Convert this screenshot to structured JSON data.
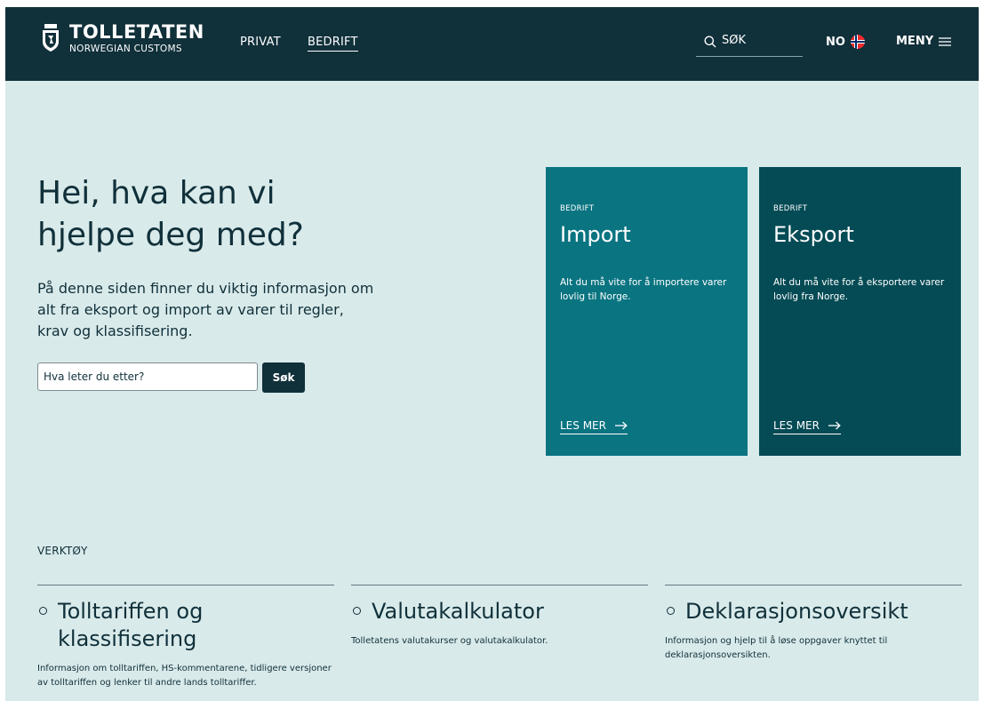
{
  "header": {
    "logo_title": "TOLLETATEN",
    "logo_subtitle": "NORWEGIAN CUSTOMS",
    "nav": [
      {
        "label": "PRIVAT"
      },
      {
        "label": "BEDRIFT",
        "active": true
      }
    ],
    "search_label": "SØK",
    "language": "NO",
    "menu_label": "MENY"
  },
  "hero": {
    "title": "Hei, hva kan vi hjelpe deg med?",
    "text": "På denne siden finner du viktig informasjon om alt fra eksport og import av varer til regler, krav og klassifisering.",
    "search_placeholder": "Hva leter du etter?",
    "search_button": "Søk"
  },
  "cards": [
    {
      "eyebrow": "BEDRIFT",
      "title": "Import",
      "description": "Alt du må vite for å importere varer lovlig til Norge.",
      "link": "LES MER",
      "color": "#0a7481"
    },
    {
      "eyebrow": "BEDRIFT",
      "title": "Eksport",
      "description": "Alt du må vite for å eksportere varer lovlig fra Norge.",
      "link": "LES MER",
      "color": "#044b55"
    }
  ],
  "tools": {
    "heading": "VERKTØY",
    "items": [
      {
        "title": "Tolltariffen og klassifisering",
        "description": "Informasjon om tolltariffen, HS-kommentarene, tidligere versjoner av tolltariffen og lenker til andre lands tolltariffer."
      },
      {
        "title": "Valutakalkulator",
        "description": "Tolletatens valutakurser og valutakalkulator."
      },
      {
        "title": "Deklarasjonsoversikt",
        "description": "Informasjon og hjelp til å løse oppgaver knyttet til deklarasjonsoversikten."
      }
    ]
  },
  "colors": {
    "header_bg": "#10303a",
    "page_bg": "#d9eaea",
    "text": "#10303a"
  },
  "icons": [
    "crest-icon",
    "search-icon",
    "norway-flag-icon",
    "hamburger-icon",
    "arrow-right-icon",
    "ring-bullet-icon"
  ]
}
